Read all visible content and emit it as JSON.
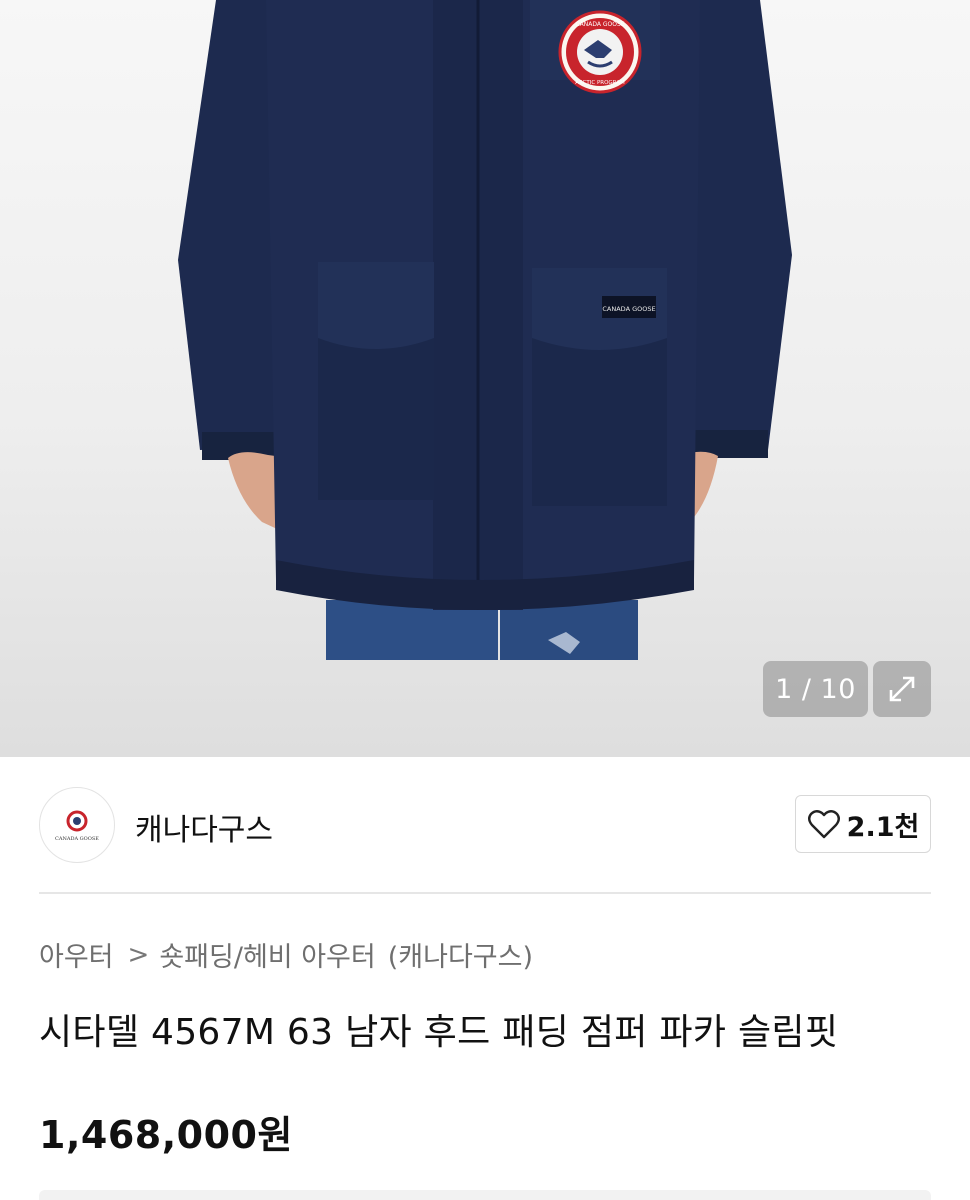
{
  "gallery": {
    "current": 1,
    "total": 10,
    "counter_text": "1 / 10",
    "expand_icon": "expand-icon",
    "brand_patch_top": "CANADA GOOSE",
    "brand_patch_bottom": "ARCTIC PROGRAM",
    "brand_label": "CANADA GOOSE"
  },
  "seller": {
    "name": "캐나다구스",
    "avatar_text": "CANADA GOOSE",
    "like_icon": "heart-outline-icon",
    "like_count": "2.1천"
  },
  "breadcrumb": {
    "category": "아우터",
    "separator": ">",
    "subcategory": "숏패딩/헤비 아우터",
    "seller": "(캐나다구스)"
  },
  "product": {
    "title": "시타델 4567M 63 남자 후드 패딩 점퍼 파카 슬림핏",
    "price": "1,468,000원"
  },
  "colors": {
    "jacket": "#1f2c52",
    "patch_red": "#c8242c",
    "text": "#111111",
    "muted": "#6f6f6f"
  }
}
